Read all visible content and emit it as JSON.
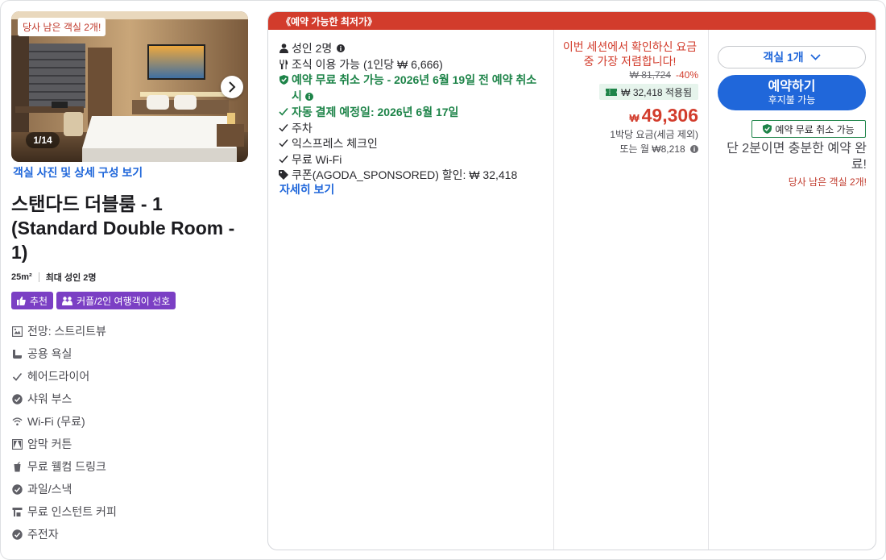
{
  "photo": {
    "badge": "당사 남은 객실 2개!",
    "counter": "1/14",
    "link": "객실 사진 및 상세 구성 보기"
  },
  "room": {
    "title": "스탠다드 더블룸 - 1 (Standard Double Room - 1)",
    "size": "25m²",
    "occupancy": "최대 성인 2명",
    "tags": [
      "추천",
      "커플/2인 여행객이 선호"
    ]
  },
  "amenities": [
    {
      "icon": "view-icon",
      "label": "전망: 스트리트뷰"
    },
    {
      "icon": "bath-icon",
      "label": "공용 욕실"
    },
    {
      "icon": "check-icon",
      "label": "헤어드라이어"
    },
    {
      "icon": "check-circle-icon",
      "label": "샤워 부스"
    },
    {
      "icon": "wifi-icon",
      "label": "Wi-Fi (무료)"
    },
    {
      "icon": "curtain-icon",
      "label": "암막 커튼"
    },
    {
      "icon": "drink-icon",
      "label": "무료 웰컴 드링크"
    },
    {
      "icon": "check-circle-icon",
      "label": "과일/스낵"
    },
    {
      "icon": "coffee-icon",
      "label": "무료 인스턴트 커피"
    },
    {
      "icon": "check-circle-icon",
      "label": "주전자"
    }
  ],
  "offer": {
    "header": "《예약 가능한 최저가》",
    "benefits": [
      {
        "icon": "person-icon",
        "text": "성인 2명",
        "style": "normal",
        "info": true
      },
      {
        "icon": "cutlery-icon",
        "text": "조식 이용 가능 (1인당 ₩ 6,666)",
        "style": "normal",
        "info": false
      },
      {
        "icon": "shield-icon",
        "text": "예약 무료 취소 가능 - 2026년 6월 19일 전 예약 취소 시",
        "style": "green",
        "info": true
      },
      {
        "icon": "check-icon",
        "text": "자동 결제 예정일: 2026년 6월 17일",
        "style": "green",
        "info": false
      },
      {
        "icon": "check-icon",
        "text": "주차",
        "style": "normal",
        "info": false
      },
      {
        "icon": "check-icon",
        "text": "익스프레스 체크인",
        "style": "normal",
        "info": false
      },
      {
        "icon": "check-icon",
        "text": "무료 Wi-Fi",
        "style": "normal",
        "info": false
      },
      {
        "icon": "tag-icon",
        "text": "쿠폰(AGODA_SPONSORED) 할인: ₩ 32,418",
        "style": "normal",
        "info": false
      }
    ],
    "more_link": "자세히 보기"
  },
  "price": {
    "session_note": "이번 세션에서 확인하신 요금 중 가장 저렴합니다!",
    "original": "₩ 81,724",
    "discount": "-40%",
    "coupon": "₩ 32,418 적용됨",
    "currency": "₩",
    "amount": "49,306",
    "per_night": "1박당 요금(세금 제외)",
    "monthly": "또는 월 ₩8,218"
  },
  "booking": {
    "room_qty": "객실 1개",
    "book_label": "예약하기",
    "book_sub": "후지불 가능",
    "free_cancel": "예약 무료 취소 가능",
    "hurry": "단 2분이면 충분한 예약 완료!",
    "last_rooms": "당사 남은 객실 2개!"
  },
  "colors": {
    "accent_blue": "#2067da",
    "alert_red": "#d23c2c",
    "success_green": "#1e8449",
    "tag_purple": "#7b3fc4"
  }
}
